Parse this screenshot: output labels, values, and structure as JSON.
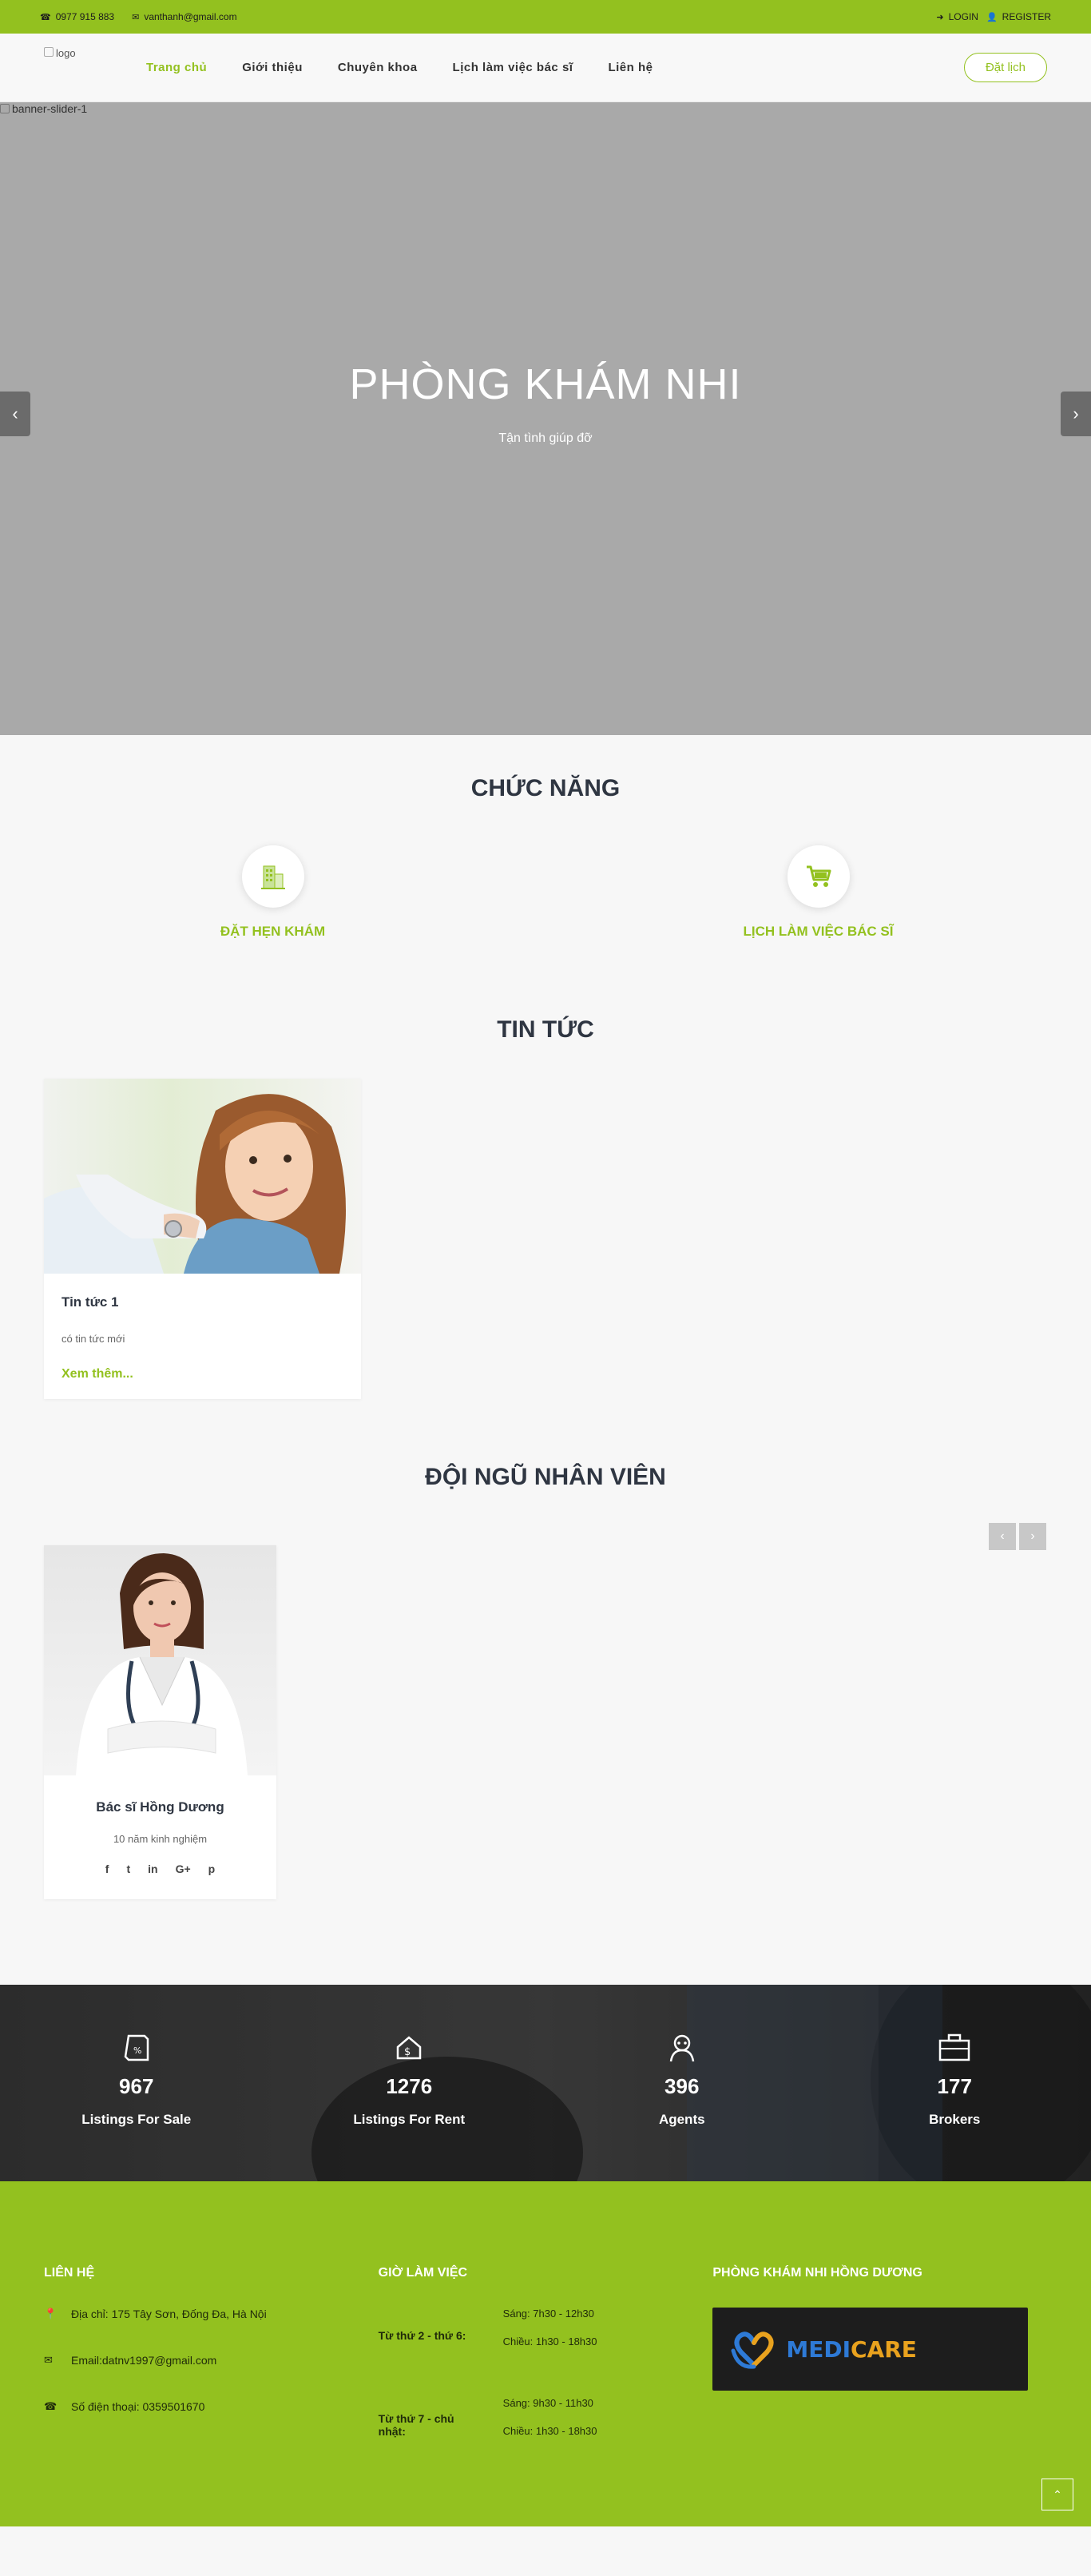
{
  "topbar": {
    "phone": "0977 915 883",
    "email": "vanthanh@gmail.com",
    "login": "LOGIN",
    "register": "REGISTER"
  },
  "nav": {
    "logo_alt": "logo",
    "items": [
      "Trang chủ",
      "Giới thiệu",
      "Chuyên khoa",
      "Lịch làm việc bác sĩ",
      "Liên hệ"
    ],
    "book_label": "Đặt lịch"
  },
  "hero": {
    "image_alt": "banner-slider-1",
    "title": "PHÒNG KHÁM NHI",
    "subtitle": "Tận tình giúp đỡ"
  },
  "features": {
    "title": "CHỨC NĂNG",
    "items": [
      {
        "label": "ĐẶT HẸN KHÁM",
        "icon": "building-icon"
      },
      {
        "label": "LỊCH LÀM VIỆC BÁC SĨ",
        "icon": "cart-icon"
      }
    ]
  },
  "news": {
    "title": "TIN TỨC",
    "items": [
      {
        "title": "Tin tức 1",
        "excerpt": "có tin tức mới",
        "more": "Xem thêm..."
      }
    ]
  },
  "team": {
    "title": "ĐỘI NGŨ NHÂN VIÊN",
    "prev": "‹",
    "next": "›",
    "members": [
      {
        "name": "Bác sĩ Hồng Dương",
        "experience": "10 năm kinh nghiệm"
      }
    ],
    "socials": [
      "f",
      "t",
      "in",
      "G+",
      "p"
    ]
  },
  "stats": [
    {
      "value": "967",
      "label": "Listings For Sale",
      "icon": "tag-icon"
    },
    {
      "value": "1276",
      "label": "Listings For Rent",
      "icon": "house-dollar-icon"
    },
    {
      "value": "396",
      "label": "Agents",
      "icon": "agent-icon"
    },
    {
      "value": "177",
      "label": "Brokers",
      "icon": "briefcase-icon"
    }
  ],
  "footer": {
    "contact_title": "LIÊN HỆ",
    "address": "Địa chỉ: 175 Tây Sơn, Đống Đa, Hà Nội",
    "email": "Email:datnv1997@gmail.com",
    "phone": "Số điện thoại: 0359501670",
    "hours_title": "GIỜ LÀM VIỆC",
    "weekdays": "Từ thứ 2 - thứ 6:",
    "weekdays_morning": "Sáng: 7h30 - 12h30",
    "weekdays_afternoon": "Chiều: 1h30 - 18h30",
    "weekend": "Từ thứ 7 - chủ nhật:",
    "weekend_morning": "Sáng: 9h30 - 11h30",
    "weekend_afternoon": "Chiều: 1h30 - 18h30",
    "clinic_title": "PHÒNG KHÁM NHI HỒNG DƯƠNG",
    "brand_a": "MEDI",
    "brand_b": "CARE"
  },
  "colors": {
    "accent": "#93c11f",
    "heading": "#2f3642"
  }
}
